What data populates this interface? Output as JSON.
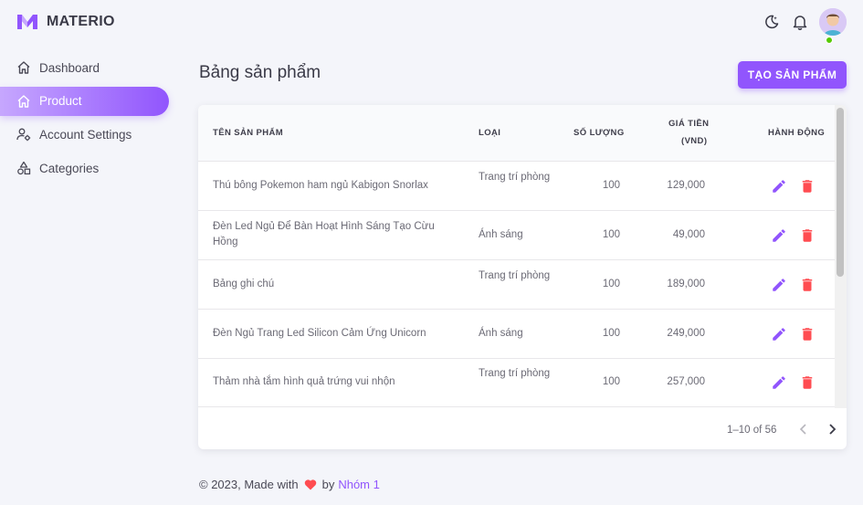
{
  "brand": {
    "name": "MATERIO",
    "logo_color": "#9155fd"
  },
  "sidebar": {
    "items": [
      {
        "label": "Dashboard",
        "icon": "home-icon",
        "active": false
      },
      {
        "label": "Product",
        "icon": "home-icon",
        "active": true
      },
      {
        "label": "Account Settings",
        "icon": "account-cog-icon",
        "active": false
      },
      {
        "label": "Categories",
        "icon": "shapes-icon",
        "active": false
      }
    ]
  },
  "topbar": {
    "icons": [
      "moon-icon",
      "bell-icon",
      "avatar"
    ],
    "status_color": "#56ca00"
  },
  "page": {
    "title": "Bảng sản phẩm",
    "create_button": "TẠO SẢN PHẨM"
  },
  "table": {
    "headers": {
      "name": "TÊN SẢN PHẨM",
      "type": "LOẠI",
      "qty": "SỐ LƯỢNG",
      "price_line1": "GIÁ TIỀN",
      "price_line2": "(VND)",
      "actions": "HÀNH ĐỘNG"
    },
    "rows": [
      {
        "name": "Thú bông Pokemon ham ngủ Kabigon Snorlax",
        "type": "Trang trí phòng",
        "qty": "100",
        "price": "129,000"
      },
      {
        "name": "Đèn Led Ngủ Để Bàn Hoạt Hình Sáng Tạo Cừu Hồng",
        "type": "Ánh sáng",
        "qty": "100",
        "price": "49,000"
      },
      {
        "name": "Bảng ghi chú",
        "type": "Trang trí phòng",
        "qty": "100",
        "price": "189,000"
      },
      {
        "name": "Đèn Ngủ Trang Led Silicon Cảm Ứng Unicorn",
        "type": "Ánh sáng",
        "qty": "100",
        "price": "249,000"
      },
      {
        "name": "Thảm nhà tắm hình quả trứng vui nhộn",
        "type": "Trang trí phòng",
        "qty": "100",
        "price": "257,000"
      }
    ],
    "edit_color": "#9155fd",
    "delete_color": "#ff4c51"
  },
  "pagination": {
    "text": "1–10 of 56"
  },
  "footer": {
    "prefix": "© 2023, Made with",
    "by": "by",
    "team": "Nhóm 1"
  }
}
